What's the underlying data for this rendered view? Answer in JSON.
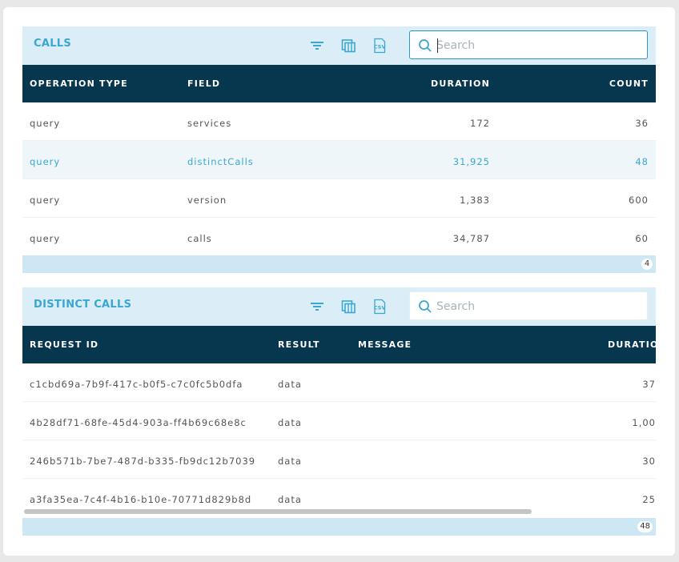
{
  "calls": {
    "title": "CALLS",
    "search_placeholder": "Search",
    "columns": [
      "OPERATION TYPE",
      "FIELD",
      "DURATION",
      "COUNT"
    ],
    "rows": [
      {
        "operation_type": "query",
        "field": "services",
        "duration": "172",
        "count": "36"
      },
      {
        "operation_type": "query",
        "field": "distinctCalls",
        "duration": "31,925",
        "count": "48"
      },
      {
        "operation_type": "query",
        "field": "version",
        "duration": "1,383",
        "count": "600"
      },
      {
        "operation_type": "query",
        "field": "calls",
        "duration": "34,787",
        "count": "60"
      }
    ],
    "total": "4"
  },
  "distinct_calls": {
    "title": "DISTINCT CALLS",
    "search_placeholder": "Search",
    "columns": [
      "REQUEST ID",
      "RESULT",
      "MESSAGE",
      "DURATIO"
    ],
    "rows": [
      {
        "request_id": "c1cbd69a-7b9f-417c-b0f5-c7c0fc5b0dfa",
        "result": "data",
        "message": "",
        "duration": "37"
      },
      {
        "request_id": "4b28df71-68fe-45d4-903a-ff4b69c68e8c",
        "result": "data",
        "message": "",
        "duration": "1,00"
      },
      {
        "request_id": "246b571b-7be7-487d-b335-fb9dc12b7039",
        "result": "data",
        "message": "",
        "duration": "30"
      },
      {
        "request_id": "a3fa35ea-7c4f-4b16-b10e-70771d829b8d",
        "result": "data",
        "message": "",
        "duration": "25"
      }
    ],
    "total": "48"
  },
  "icons": {
    "filter": "filter-icon",
    "columns": "column-chooser-icon",
    "csv": "csv-export-icon",
    "search": "search-icon"
  },
  "colors": {
    "accent": "#3aa7d0",
    "header_bg": "#07364f",
    "panel_bg": "#dbeef8",
    "footer_bg": "#cde8f4"
  }
}
